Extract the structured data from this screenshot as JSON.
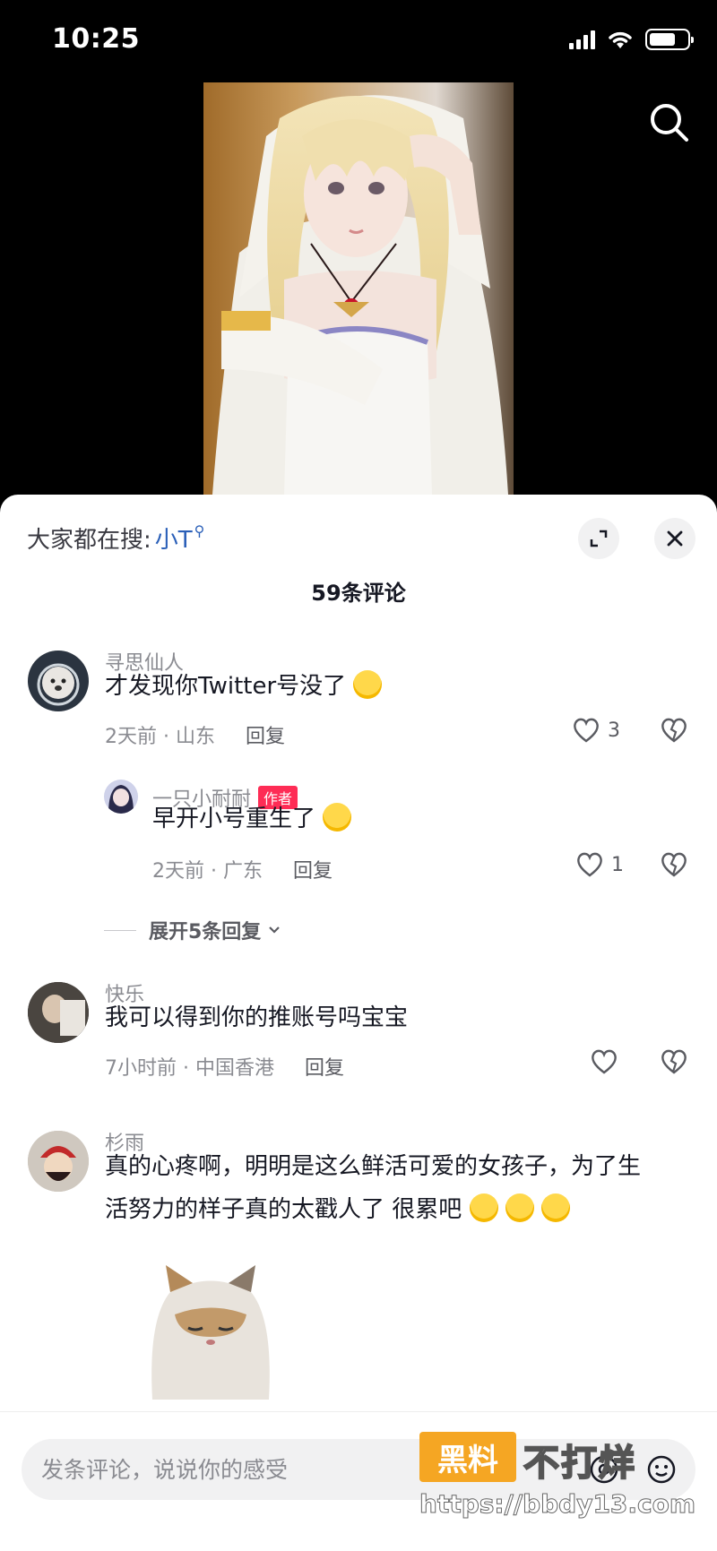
{
  "status_bar": {
    "time": "10:25",
    "battery_level": 0.7
  },
  "icons": {
    "search": "search-icon",
    "expand": "expand-icon",
    "close": "close-icon",
    "like": "heart-icon",
    "dislike": "broken-heart-icon"
  },
  "header": {
    "trending_prefix": "大家都在搜:",
    "trending_term": "小T",
    "comment_count": "59条评论"
  },
  "comments": [
    {
      "author": "寻思仙人",
      "text": "才发现你Twitter号没了",
      "time_location": "2天前 · 山东",
      "reply_label": "回复",
      "likes": "3",
      "emoji": "laughing-crying-emoji"
    },
    {
      "author": "一只小耐耐",
      "badge": "作者",
      "text": "早开小号重生了",
      "time_location": "2天前 · 广东",
      "reply_label": "回复",
      "likes": "1",
      "emoji": "smirk-emoji",
      "is_reply": true
    },
    {
      "author": "快乐",
      "text": "我可以得到你的推账号吗宝宝",
      "time_location": "7小时前 · 中国香港",
      "reply_label": "回复",
      "likes": ""
    },
    {
      "author": "杉雨",
      "text_line1": "真的心疼啊，明明是这么鲜活可爱的女孩子，为了生",
      "text_line2": "活努力的样子真的太戳人了 很累吧",
      "emoji": "pleading-face-emoji"
    }
  ],
  "expand_replies": "展开5条回复",
  "input": {
    "placeholder": "发条评论，说说你的感受"
  },
  "watermark": {
    "logo": "黑料",
    "text": "不打烊",
    "url": "https://bbdy13.com"
  }
}
